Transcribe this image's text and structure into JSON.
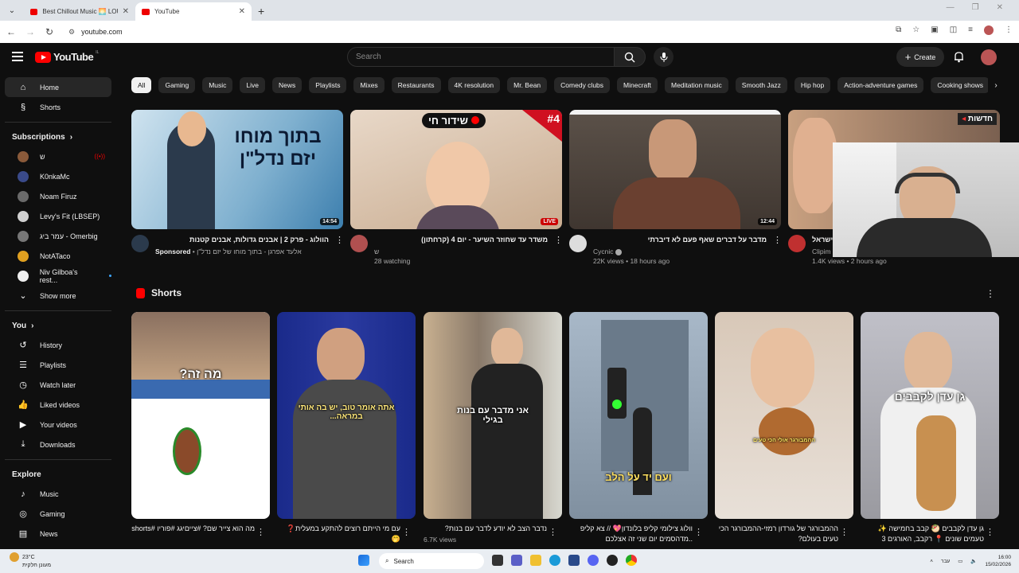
{
  "browser": {
    "tabs": [
      {
        "title": "Best Chillout Music 🌅 LOUNGE"
      },
      {
        "title": "YouTube"
      }
    ],
    "url": "youtube.com"
  },
  "masthead": {
    "logo_text": "YouTube",
    "region": "IL",
    "search_placeholder": "Search",
    "create_label": "Create"
  },
  "sidebar": {
    "home": "Home",
    "shorts": "Shorts",
    "subscriptions_header": "Subscriptions",
    "subscriptions": [
      {
        "name": "ש"
      },
      {
        "name": "K0nkaMc"
      },
      {
        "name": "Noam Firuz"
      },
      {
        "name": "Levy's Fit (LBSEP)"
      },
      {
        "name": "עמר ביג - Omerbig"
      },
      {
        "name": "NotATaco"
      },
      {
        "name": "Niv Gilboa's rest..."
      }
    ],
    "show_more": "Show more",
    "you_header": "You",
    "you_items": [
      "History",
      "Playlists",
      "Watch later",
      "Liked videos",
      "Your videos",
      "Downloads"
    ],
    "explore_header": "Explore",
    "explore_items": [
      "Music",
      "Gaming",
      "News"
    ]
  },
  "chips": [
    "All",
    "Gaming",
    "Music",
    "Live",
    "News",
    "Playlists",
    "Mixes",
    "Restaurants",
    "4K resolution",
    "Mr. Bean",
    "Comedy clubs",
    "Minecraft",
    "Meditation music",
    "Smooth Jazz",
    "Hip hop",
    "Action-adventure games",
    "Cooking shows"
  ],
  "videos": [
    {
      "title": "הוולוג - פרק 2 | אבנים גדולות, אבנים קטנות",
      "channel": "אלעד אפרגן - בתוך מוחו של יזם נדל\"ן",
      "badge": "Sponsored",
      "meta": "",
      "duration": "14:54",
      "thumb_text": "בתוך מוחו יזם נדל\"ן"
    },
    {
      "title": "משדר עד שחוזר השיער - יום 4 (קרחתון)",
      "channel": "ש",
      "meta": "28 watching",
      "live": "LIVE",
      "thumb_text": "שידור חי",
      "rank": "#4"
    },
    {
      "title": "מדבר על דברים שאף פעם לא דיברתי",
      "channel": "Cycnic",
      "meta": "22K views • 18 hours ago",
      "duration": "12:44"
    },
    {
      "title": "ישראל",
      "channel": "Clipim",
      "meta": "1.4K views • 2 hours ago",
      "thumb_text": "חדשות"
    }
  ],
  "shorts": {
    "header": "Shorts",
    "items": [
      {
        "title": "מה הוא צייר שם? #צייםיגג #פוריו #shorts",
        "views": "",
        "caption": "מה זה?"
      },
      {
        "title": "עם מי הייתם רוצים להתקע במעלית❓ 🤭",
        "views": "",
        "caption": "אתה אומר טוב, יש בה אותי במראה..."
      },
      {
        "title": "נדבר הצב לא יודע לדבר עם בנות?",
        "views": "6.7K views",
        "caption": "אני מדבר עם בנות בגילי"
      },
      {
        "title": "וולוג צילומי קליפ בלונדון💖 // צא קליפ ..מדהסמים יום שני זה אצלכם",
        "views": "",
        "caption": "ועם יד על הלב"
      },
      {
        "title": "ההמבורגר של גורדון רמזי-ההמבורגר הכי טעים בעולם?",
        "views": "",
        "caption": "ההמבורגר אולי הכי טעים"
      },
      {
        "title": "גן עדן לקבבים 🥙 קבב בחמישה ✨ טעמים שונים 📍 רקבב, האורגים 3",
        "views": "",
        "caption": "גן עדן לקבבים"
      }
    ]
  },
  "taskbar": {
    "temp": "23°C",
    "weather": "מעונן חלקית",
    "search": "Search",
    "lang": "עבר",
    "time": "16:00",
    "date": "15/02/2026"
  },
  "colors": {
    "yt_red": "#ff0000",
    "bg": "#0f0f0f",
    "chip": "#272727"
  }
}
